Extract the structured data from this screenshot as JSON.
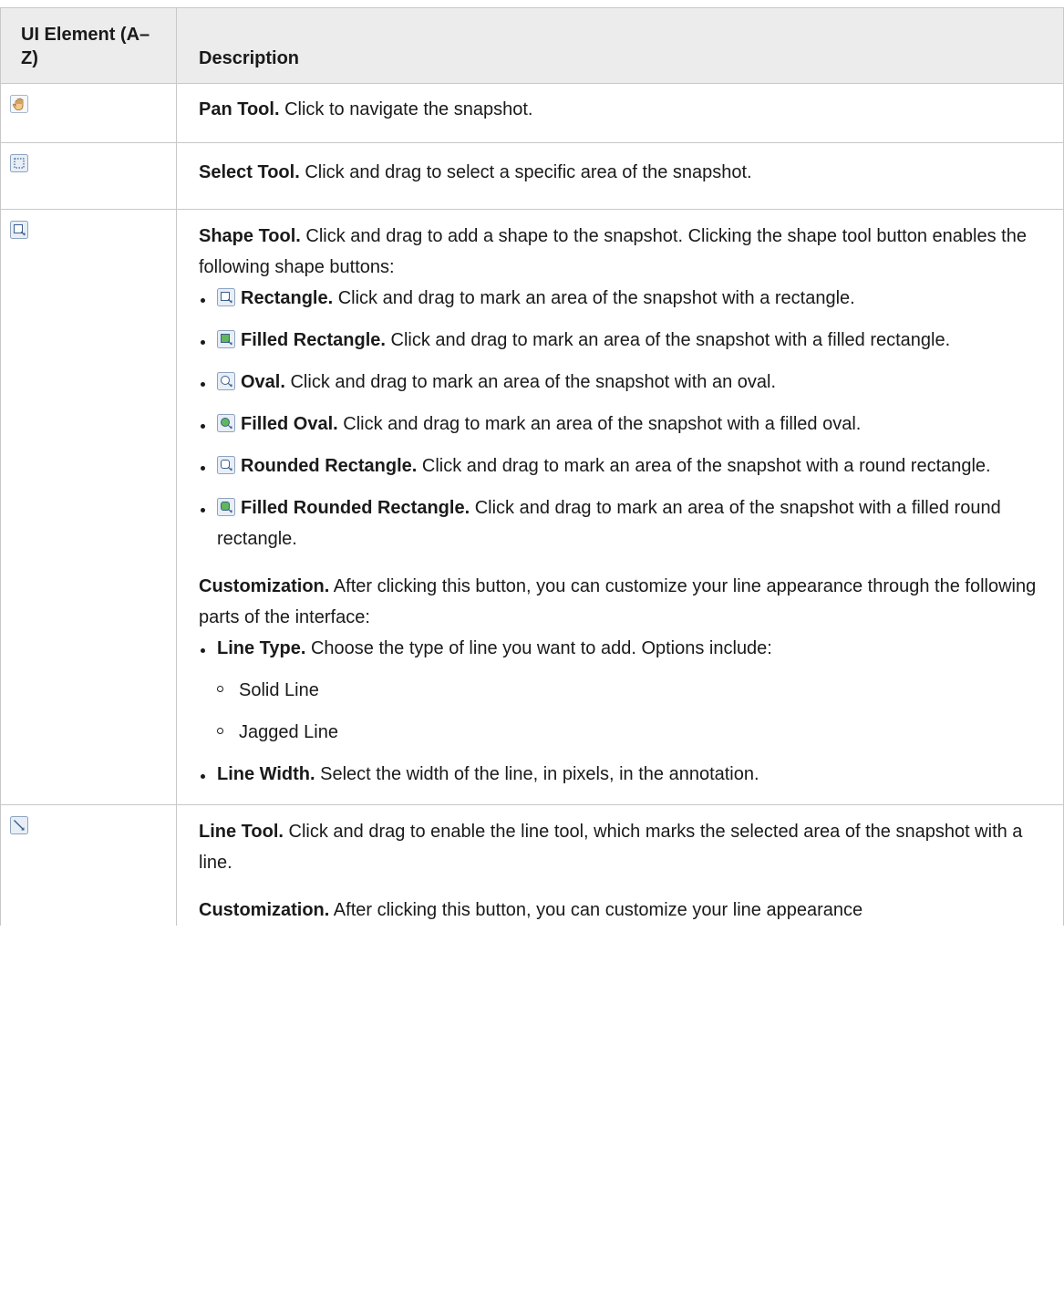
{
  "header": {
    "ui_element": "UI Element (A–Z)",
    "description": "Description"
  },
  "rows": [
    {
      "icon": "pan-hand-icon",
      "title": "Pan Tool.",
      "text": "Click to navigate the snapshot."
    },
    {
      "icon": "select-tool-icon",
      "title": "Select Tool.",
      "text": "Click and drag to select a specific area of the snapshot."
    },
    {
      "icon": "shape-tool-icon",
      "title": "Shape Tool.",
      "text": "Click and drag to add a shape to the snapshot. Clicking the shape tool button enables the following shape buttons:",
      "shapes": [
        {
          "icon": "rectangle-icon",
          "title": "Rectangle.",
          "text": "Click and drag to mark an area of the snapshot with a rectangle."
        },
        {
          "icon": "filled-rectangle-icon",
          "title": "Filled Rectangle.",
          "text": "Click and drag to mark an area of the snapshot with a filled rectangle."
        },
        {
          "icon": "oval-icon",
          "title": "Oval.",
          "text": "Click and drag to mark an area of the snapshot with an oval."
        },
        {
          "icon": "filled-oval-icon",
          "title": "Filled Oval.",
          "text": "Click and drag to mark an area of the snapshot with a filled oval."
        },
        {
          "icon": "rounded-rectangle-icon",
          "title": "Rounded Rectangle.",
          "text": "Click and drag to mark an area of the snapshot with a round rectangle."
        },
        {
          "icon": "filled-rounded-rectangle-icon",
          "title": "Filled Rounded Rectangle.",
          "text": "Click and drag to mark an area of the snapshot with a filled round rectangle."
        }
      ],
      "customization": {
        "title": "Customization.",
        "text": "After clicking this button, you can customize your line appearance through the following parts of the interface:",
        "line_type": {
          "title": "Line Type.",
          "text": "Choose the type of line you want to add. Options include:",
          "options": [
            "Solid Line",
            "Jagged Line"
          ]
        },
        "line_width": {
          "title": "Line Width.",
          "text": "Select the width of the line, in pixels, in the annotation."
        }
      }
    },
    {
      "icon": "line-tool-icon",
      "title": "Line Tool.",
      "text": "Click and drag to enable the line tool, which marks the selected area of the snapshot with a line.",
      "customization": {
        "title": "Customization.",
        "text": "After clicking this button, you can customize your line appearance"
      }
    }
  ]
}
